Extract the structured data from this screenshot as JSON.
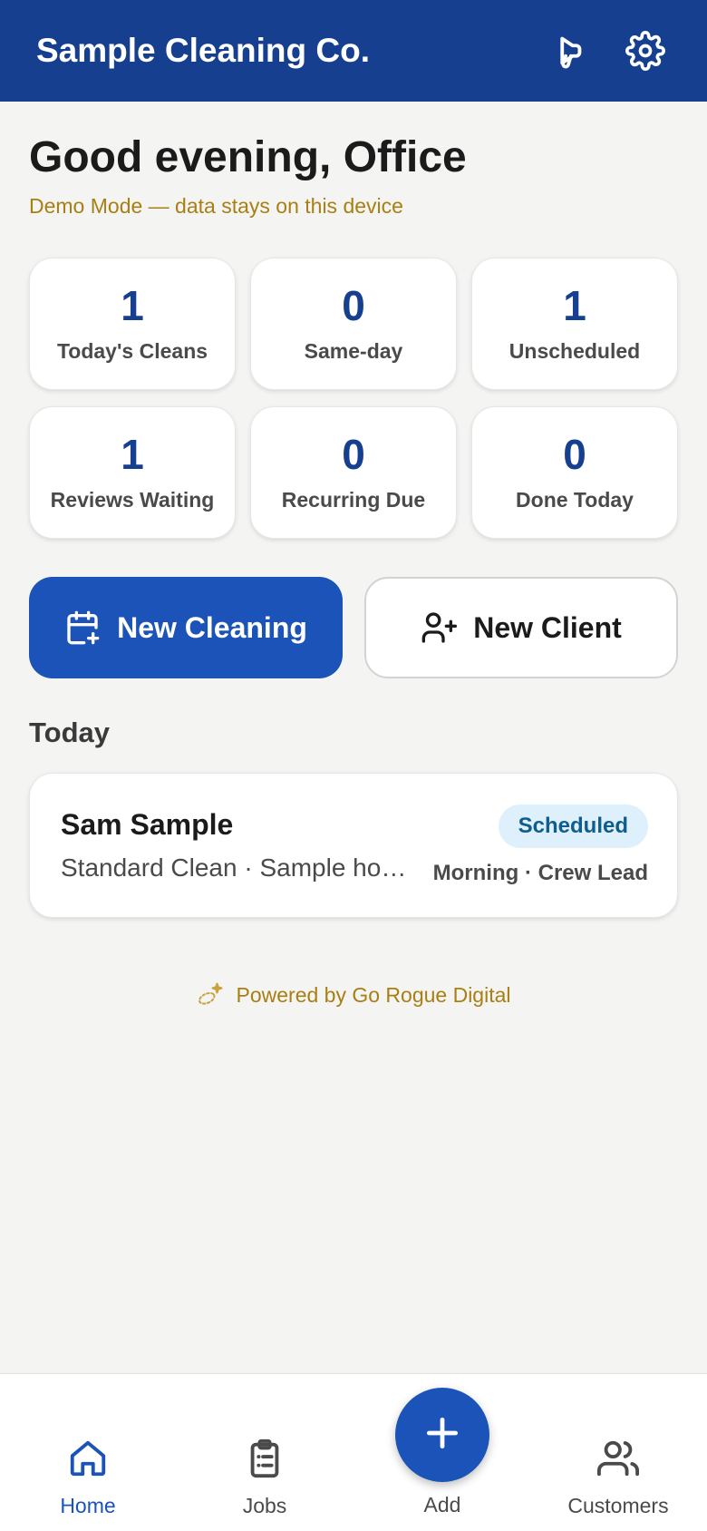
{
  "header": {
    "title": "Sample Cleaning Co.",
    "icons": [
      "megaphone-icon",
      "gear-icon"
    ],
    "background_color": "#163f8f"
  },
  "greeting": "Good evening, Office",
  "demo_note": "Demo Mode — data stays on this device",
  "stats": [
    {
      "value": "1",
      "label": "Today's Cleans"
    },
    {
      "value": "0",
      "label": "Same-day"
    },
    {
      "value": "1",
      "label": "Unscheduled"
    },
    {
      "value": "1",
      "label": "Reviews Waiting"
    },
    {
      "value": "0",
      "label": "Recurring Due"
    },
    {
      "value": "0",
      "label": "Done Today"
    }
  ],
  "actions": {
    "new_cleaning": {
      "label": "New Cleaning",
      "icon": "calendar-plus-icon"
    },
    "new_client": {
      "label": "New Client",
      "icon": "user-plus-icon"
    }
  },
  "today": {
    "title": "Today",
    "jobs": [
      {
        "client": "Sam Sample",
        "description": "Standard Clean · Sample home",
        "status": "Scheduled",
        "meta": "Morning · Crew Lead"
      }
    ]
  },
  "powered_by": "Powered by Go Rogue Digital",
  "nav": {
    "home": "Home",
    "jobs": "Jobs",
    "add": "Add",
    "customers": "Customers"
  },
  "colors": {
    "brand": "#163f8f",
    "accent": "#1b53b8",
    "gold": "#a97f14",
    "badge_bg": "#def0fb",
    "badge_text": "#0f5d8c"
  }
}
